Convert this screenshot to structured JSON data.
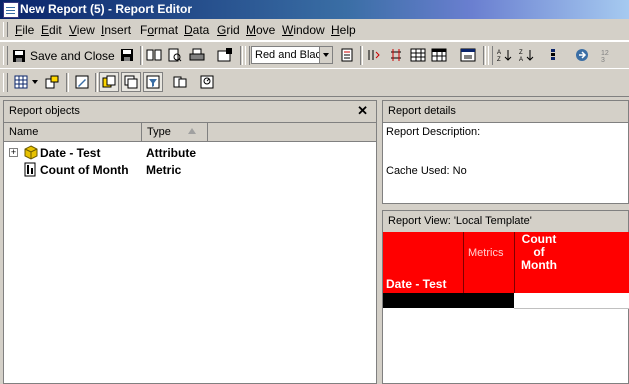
{
  "window": {
    "title": "New Report (5) - Report Editor"
  },
  "menu": [
    {
      "label": "File",
      "accel": "F"
    },
    {
      "label": "Edit",
      "accel": "E"
    },
    {
      "label": "View",
      "accel": "V"
    },
    {
      "label": "Insert",
      "accel": "I"
    },
    {
      "label": "Format",
      "accel": "o"
    },
    {
      "label": "Data",
      "accel": "D"
    },
    {
      "label": "Grid",
      "accel": "G"
    },
    {
      "label": "Move",
      "accel": "M"
    },
    {
      "label": "Window",
      "accel": "W"
    },
    {
      "label": "Help",
      "accel": "H"
    }
  ],
  "toolbar": {
    "save_close_label": "Save and Close",
    "style_combo_value": "Red and Black"
  },
  "report_objects": {
    "title": "Report objects",
    "col_name": "Name",
    "col_type": "Type",
    "items": [
      {
        "name": "Date - Test",
        "type": "Attribute"
      },
      {
        "name": "Count of Month",
        "type": "Metric"
      }
    ]
  },
  "report_details": {
    "title": "Report details",
    "description_label": "Report Description:",
    "cache_label": "Cache Used: No"
  },
  "report_view": {
    "title": "Report View: 'Local Template'",
    "metrics_header": "Metrics",
    "metric_col_line1": "Count",
    "metric_col_line2": "of",
    "metric_col_line3": "Month",
    "row_header": "Date - Test"
  },
  "colors": {
    "grid_header": "#ff0000",
    "grid_row": "#000000",
    "title_start": "#0a246a"
  }
}
